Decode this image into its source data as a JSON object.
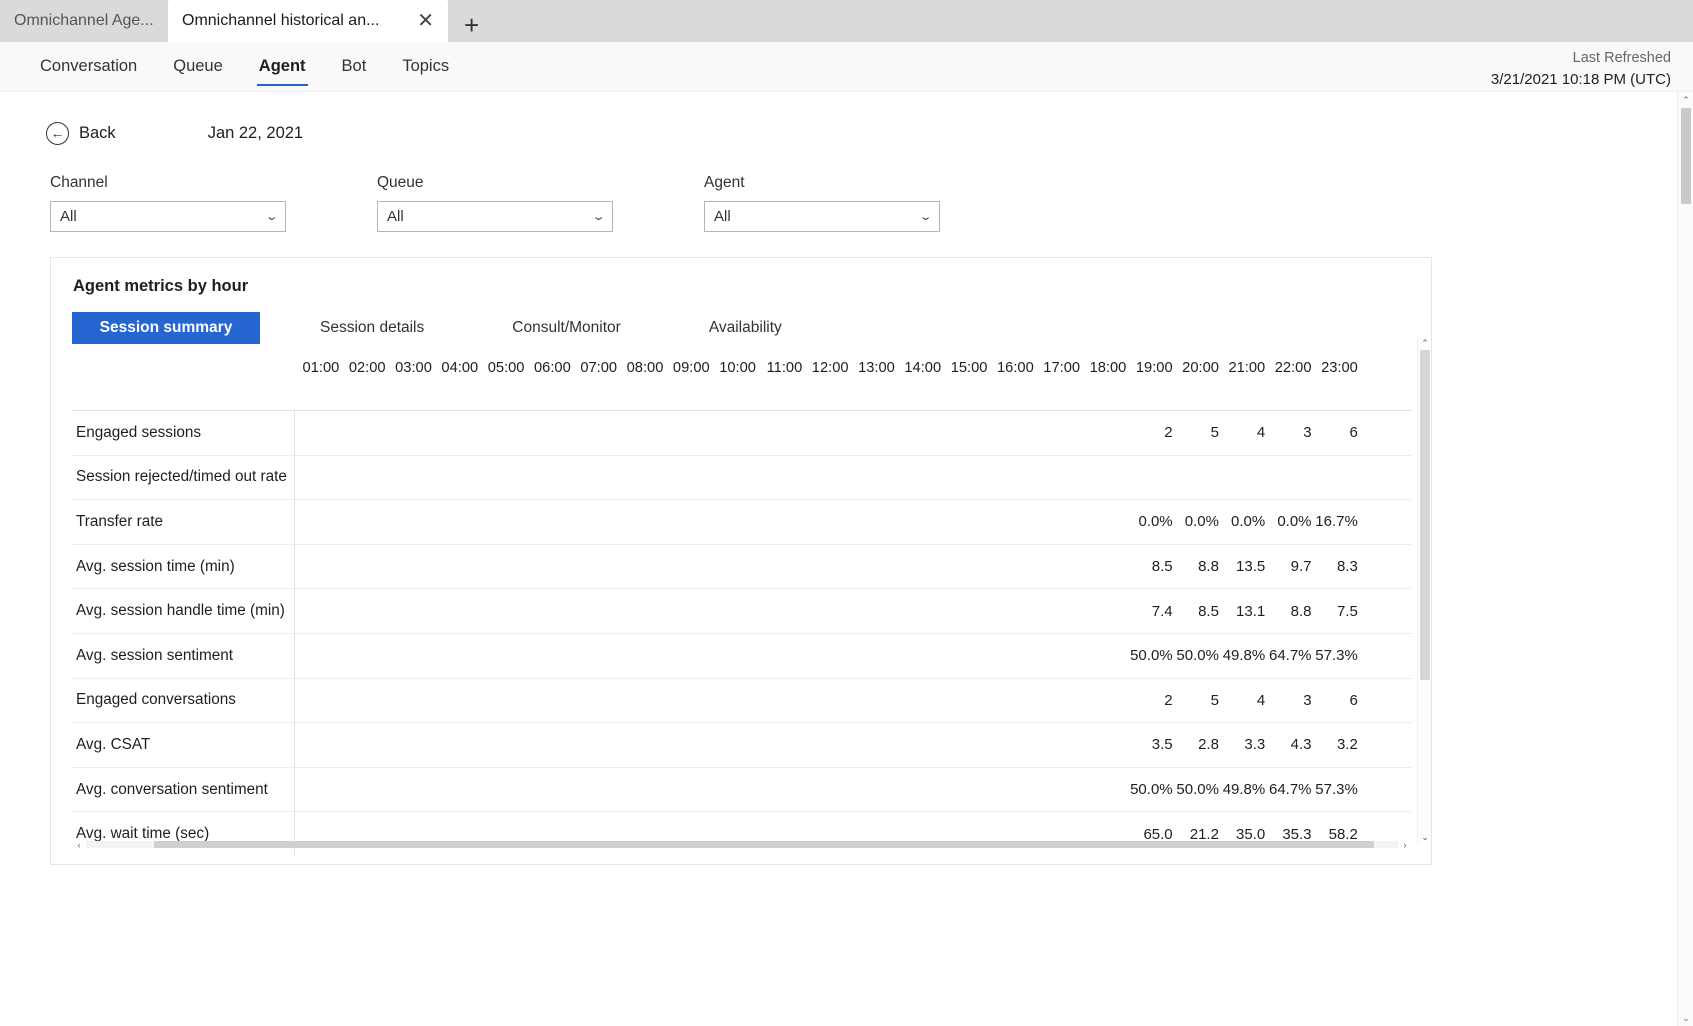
{
  "browser": {
    "tabs": [
      {
        "title": "Omnichannel Age...",
        "active": false
      },
      {
        "title": "Omnichannel historical an...",
        "active": true
      }
    ],
    "close_icon": "✕",
    "new_tab_icon": "+"
  },
  "nav": {
    "items": [
      {
        "label": "Conversation",
        "selected": false
      },
      {
        "label": "Queue",
        "selected": false
      },
      {
        "label": "Agent",
        "selected": true
      },
      {
        "label": "Bot",
        "selected": false
      },
      {
        "label": "Topics",
        "selected": false
      }
    ],
    "refresh_label": "Last Refreshed",
    "refresh_value": "3/21/2021 10:18 PM (UTC)"
  },
  "toolbar": {
    "back_label": "Back",
    "back_icon": "←",
    "date_label": "Jan 22, 2021"
  },
  "filters": [
    {
      "label": "Channel",
      "value": "All",
      "chevron": "⌄"
    },
    {
      "label": "Queue",
      "value": "All",
      "chevron": "⌄"
    },
    {
      "label": "Agent",
      "value": "All",
      "chevron": "⌄"
    }
  ],
  "card": {
    "title": "Agent metrics by hour",
    "pivots": [
      {
        "label": "Session summary",
        "active": true
      },
      {
        "label": "Session details",
        "active": false
      },
      {
        "label": "Consult/Monitor",
        "active": false
      },
      {
        "label": "Availability",
        "active": false
      }
    ]
  },
  "scrollbars": {
    "up_arrow": "⌃",
    "down_arrow": "⌄",
    "left_arrow": "‹",
    "right_arrow": "›"
  },
  "chart_data": {
    "type": "table",
    "title": "Agent metrics by hour",
    "categories": [
      "01:00",
      "02:00",
      "03:00",
      "04:00",
      "05:00",
      "06:00",
      "07:00",
      "08:00",
      "09:00",
      "10:00",
      "11:00",
      "12:00",
      "13:00",
      "14:00",
      "15:00",
      "16:00",
      "17:00",
      "18:00",
      "19:00",
      "20:00",
      "21:00",
      "22:00",
      "23:00"
    ],
    "series": [
      {
        "name": "Engaged sessions",
        "values": [
          "",
          "",
          "",
          "",
          "",
          "",
          "",
          "",
          "",
          "",
          "",
          "",
          "",
          "",
          "",
          "",
          "",
          "",
          "2",
          "5",
          "4",
          "3",
          "6"
        ]
      },
      {
        "name": "Session rejected/timed out rate",
        "values": [
          "",
          "",
          "",
          "",
          "",
          "",
          "",
          "",
          "",
          "",
          "",
          "",
          "",
          "",
          "",
          "",
          "",
          "",
          "",
          "",
          "",
          "",
          ""
        ]
      },
      {
        "name": "Transfer rate",
        "values": [
          "",
          "",
          "",
          "",
          "",
          "",
          "",
          "",
          "",
          "",
          "",
          "",
          "",
          "",
          "",
          "",
          "",
          "",
          "0.0%",
          "0.0%",
          "0.0%",
          "0.0%",
          "16.7%"
        ]
      },
      {
        "name": "Avg. session time (min)",
        "values": [
          "",
          "",
          "",
          "",
          "",
          "",
          "",
          "",
          "",
          "",
          "",
          "",
          "",
          "",
          "",
          "",
          "",
          "",
          "8.5",
          "8.8",
          "13.5",
          "9.7",
          "8.3"
        ]
      },
      {
        "name": "Avg. session handle time (min)",
        "values": [
          "",
          "",
          "",
          "",
          "",
          "",
          "",
          "",
          "",
          "",
          "",
          "",
          "",
          "",
          "",
          "",
          "",
          "",
          "7.4",
          "8.5",
          "13.1",
          "8.8",
          "7.5"
        ]
      },
      {
        "name": "Avg. session sentiment",
        "values": [
          "",
          "",
          "",
          "",
          "",
          "",
          "",
          "",
          "",
          "",
          "",
          "",
          "",
          "",
          "",
          "",
          "",
          "",
          "50.0%",
          "50.0%",
          "49.8%",
          "64.7%",
          "57.3%"
        ]
      },
      {
        "name": "Engaged conversations",
        "values": [
          "",
          "",
          "",
          "",
          "",
          "",
          "",
          "",
          "",
          "",
          "",
          "",
          "",
          "",
          "",
          "",
          "",
          "",
          "2",
          "5",
          "4",
          "3",
          "6"
        ]
      },
      {
        "name": "Avg. CSAT",
        "values": [
          "",
          "",
          "",
          "",
          "",
          "",
          "",
          "",
          "",
          "",
          "",
          "",
          "",
          "",
          "",
          "",
          "",
          "",
          "3.5",
          "2.8",
          "3.3",
          "4.3",
          "3.2"
        ]
      },
      {
        "name": "Avg. conversation sentiment",
        "values": [
          "",
          "",
          "",
          "",
          "",
          "",
          "",
          "",
          "",
          "",
          "",
          "",
          "",
          "",
          "",
          "",
          "",
          "",
          "50.0%",
          "50.0%",
          "49.8%",
          "64.7%",
          "57.3%"
        ]
      },
      {
        "name": "Avg. wait time (sec)",
        "values": [
          "",
          "",
          "",
          "",
          "",
          "",
          "",
          "",
          "",
          "",
          "",
          "",
          "",
          "",
          "",
          "",
          "",
          "",
          "65.0",
          "21.2",
          "35.0",
          "35.3",
          "58.2"
        ]
      }
    ],
    "xlabel": "",
    "ylabel": "",
    "grid": true,
    "legend": "none"
  }
}
